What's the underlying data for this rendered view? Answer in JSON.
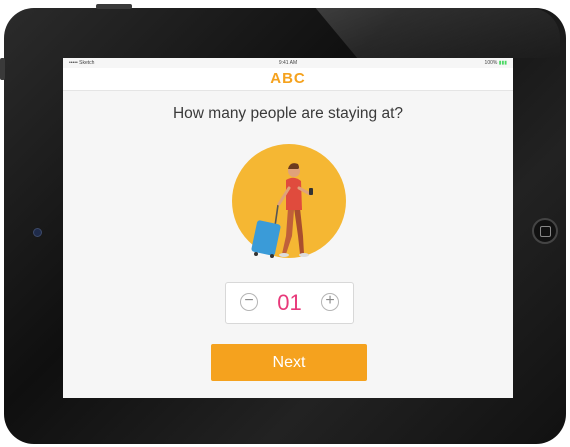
{
  "status_bar": {
    "carrier": "••••• Sketch",
    "time": "9:41 AM",
    "battery": "100%"
  },
  "header": {
    "logo": "ABC"
  },
  "main": {
    "question": "How many people are staying at?",
    "stepper": {
      "decrement": "−",
      "value": "01",
      "increment": "+"
    },
    "next_label": "Next"
  },
  "colors": {
    "accent": "#f5a21e",
    "count": "#e8397a",
    "illustration_bg": "#f5b733"
  }
}
